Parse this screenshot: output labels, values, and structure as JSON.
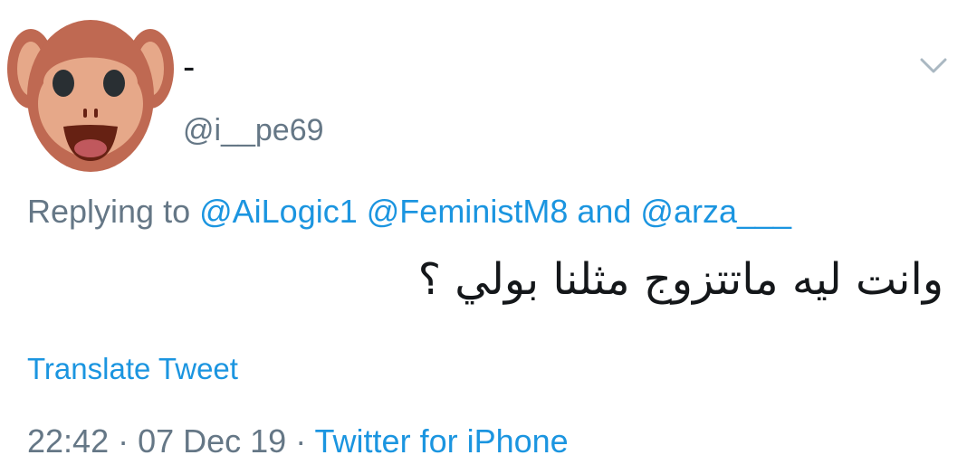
{
  "tweet": {
    "display_name": "-",
    "handle": "@i__pe69",
    "avatar_icon": "see-no-evil-monkey-icon",
    "menu_icon": "chevron-down-icon",
    "reply": {
      "prefix": "Replying to ",
      "mentions": [
        "@AiLogic1",
        "@FeministM8",
        "@arza___"
      ],
      "joiner": " and "
    },
    "text": "وانت ليه ماتتزوج مثلنا بولي ؟",
    "translate_label": "Translate Tweet",
    "time": "22:42",
    "separator": " · ",
    "date": "07 Dec 19",
    "source": "Twitter for iPhone"
  },
  "colors": {
    "link": "#1b95e0",
    "secondary_text": "#657786",
    "primary_text": "#14171a",
    "monkey_fur": "#bf6952",
    "monkey_face": "#e6a889"
  }
}
